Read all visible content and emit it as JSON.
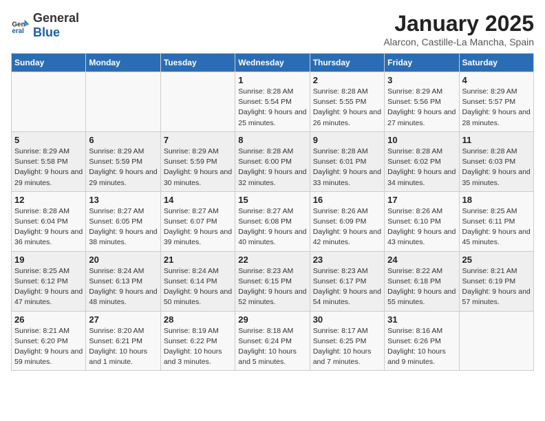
{
  "header": {
    "logo_general": "General",
    "logo_blue": "Blue",
    "title": "January 2025",
    "subtitle": "Alarcon, Castille-La Mancha, Spain"
  },
  "calendar": {
    "weekdays": [
      "Sunday",
      "Monday",
      "Tuesday",
      "Wednesday",
      "Thursday",
      "Friday",
      "Saturday"
    ],
    "weeks": [
      [
        {
          "day": "",
          "info": ""
        },
        {
          "day": "",
          "info": ""
        },
        {
          "day": "",
          "info": ""
        },
        {
          "day": "1",
          "info": "Sunrise: 8:28 AM\nSunset: 5:54 PM\nDaylight: 9 hours and 25 minutes."
        },
        {
          "day": "2",
          "info": "Sunrise: 8:28 AM\nSunset: 5:55 PM\nDaylight: 9 hours and 26 minutes."
        },
        {
          "day": "3",
          "info": "Sunrise: 8:29 AM\nSunset: 5:56 PM\nDaylight: 9 hours and 27 minutes."
        },
        {
          "day": "4",
          "info": "Sunrise: 8:29 AM\nSunset: 5:57 PM\nDaylight: 9 hours and 28 minutes."
        }
      ],
      [
        {
          "day": "5",
          "info": "Sunrise: 8:29 AM\nSunset: 5:58 PM\nDaylight: 9 hours and 29 minutes."
        },
        {
          "day": "6",
          "info": "Sunrise: 8:29 AM\nSunset: 5:59 PM\nDaylight: 9 hours and 29 minutes."
        },
        {
          "day": "7",
          "info": "Sunrise: 8:29 AM\nSunset: 5:59 PM\nDaylight: 9 hours and 30 minutes."
        },
        {
          "day": "8",
          "info": "Sunrise: 8:28 AM\nSunset: 6:00 PM\nDaylight: 9 hours and 32 minutes."
        },
        {
          "day": "9",
          "info": "Sunrise: 8:28 AM\nSunset: 6:01 PM\nDaylight: 9 hours and 33 minutes."
        },
        {
          "day": "10",
          "info": "Sunrise: 8:28 AM\nSunset: 6:02 PM\nDaylight: 9 hours and 34 minutes."
        },
        {
          "day": "11",
          "info": "Sunrise: 8:28 AM\nSunset: 6:03 PM\nDaylight: 9 hours and 35 minutes."
        }
      ],
      [
        {
          "day": "12",
          "info": "Sunrise: 8:28 AM\nSunset: 6:04 PM\nDaylight: 9 hours and 36 minutes."
        },
        {
          "day": "13",
          "info": "Sunrise: 8:27 AM\nSunset: 6:05 PM\nDaylight: 9 hours and 38 minutes."
        },
        {
          "day": "14",
          "info": "Sunrise: 8:27 AM\nSunset: 6:07 PM\nDaylight: 9 hours and 39 minutes."
        },
        {
          "day": "15",
          "info": "Sunrise: 8:27 AM\nSunset: 6:08 PM\nDaylight: 9 hours and 40 minutes."
        },
        {
          "day": "16",
          "info": "Sunrise: 8:26 AM\nSunset: 6:09 PM\nDaylight: 9 hours and 42 minutes."
        },
        {
          "day": "17",
          "info": "Sunrise: 8:26 AM\nSunset: 6:10 PM\nDaylight: 9 hours and 43 minutes."
        },
        {
          "day": "18",
          "info": "Sunrise: 8:25 AM\nSunset: 6:11 PM\nDaylight: 9 hours and 45 minutes."
        }
      ],
      [
        {
          "day": "19",
          "info": "Sunrise: 8:25 AM\nSunset: 6:12 PM\nDaylight: 9 hours and 47 minutes."
        },
        {
          "day": "20",
          "info": "Sunrise: 8:24 AM\nSunset: 6:13 PM\nDaylight: 9 hours and 48 minutes."
        },
        {
          "day": "21",
          "info": "Sunrise: 8:24 AM\nSunset: 6:14 PM\nDaylight: 9 hours and 50 minutes."
        },
        {
          "day": "22",
          "info": "Sunrise: 8:23 AM\nSunset: 6:15 PM\nDaylight: 9 hours and 52 minutes."
        },
        {
          "day": "23",
          "info": "Sunrise: 8:23 AM\nSunset: 6:17 PM\nDaylight: 9 hours and 54 minutes."
        },
        {
          "day": "24",
          "info": "Sunrise: 8:22 AM\nSunset: 6:18 PM\nDaylight: 9 hours and 55 minutes."
        },
        {
          "day": "25",
          "info": "Sunrise: 8:21 AM\nSunset: 6:19 PM\nDaylight: 9 hours and 57 minutes."
        }
      ],
      [
        {
          "day": "26",
          "info": "Sunrise: 8:21 AM\nSunset: 6:20 PM\nDaylight: 9 hours and 59 minutes."
        },
        {
          "day": "27",
          "info": "Sunrise: 8:20 AM\nSunset: 6:21 PM\nDaylight: 10 hours and 1 minute."
        },
        {
          "day": "28",
          "info": "Sunrise: 8:19 AM\nSunset: 6:22 PM\nDaylight: 10 hours and 3 minutes."
        },
        {
          "day": "29",
          "info": "Sunrise: 8:18 AM\nSunset: 6:24 PM\nDaylight: 10 hours and 5 minutes."
        },
        {
          "day": "30",
          "info": "Sunrise: 8:17 AM\nSunset: 6:25 PM\nDaylight: 10 hours and 7 minutes."
        },
        {
          "day": "31",
          "info": "Sunrise: 8:16 AM\nSunset: 6:26 PM\nDaylight: 10 hours and 9 minutes."
        },
        {
          "day": "",
          "info": ""
        }
      ]
    ]
  }
}
